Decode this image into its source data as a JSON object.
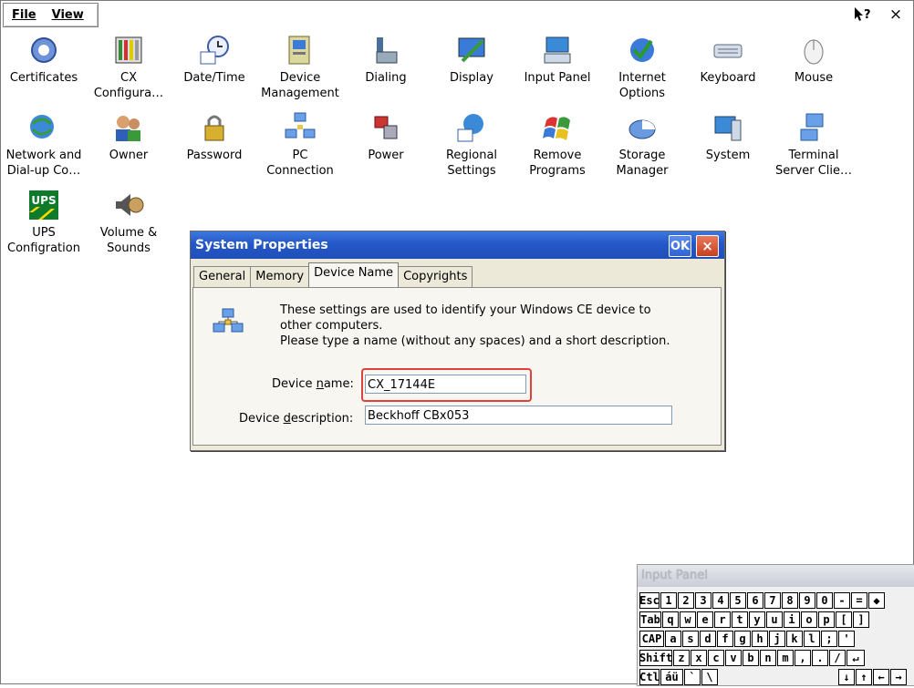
{
  "menu": {
    "file": "File",
    "view": "View"
  },
  "titlebar_controls": {
    "help": "?",
    "close": "×"
  },
  "icons": [
    {
      "label": "Certificates",
      "name": "certificates-icon"
    },
    {
      "label": "CX\nConfigura…",
      "name": "cx-configuration-icon"
    },
    {
      "label": "Date/Time",
      "name": "date-time-icon"
    },
    {
      "label": "Device\nManagement",
      "name": "device-management-icon"
    },
    {
      "label": "Dialing",
      "name": "dialing-icon"
    },
    {
      "label": "Display",
      "name": "display-icon"
    },
    {
      "label": "Input Panel",
      "name": "input-panel-icon"
    },
    {
      "label": "Internet\nOptions",
      "name": "internet-options-icon"
    },
    {
      "label": "Keyboard",
      "name": "keyboard-icon"
    },
    {
      "label": "Mouse",
      "name": "mouse-icon"
    },
    {
      "label": "Network and\nDial-up Co…",
      "name": "network-icon"
    },
    {
      "label": "Owner",
      "name": "owner-icon"
    },
    {
      "label": "Password",
      "name": "password-icon"
    },
    {
      "label": "PC\nConnection",
      "name": "pc-connection-icon"
    },
    {
      "label": "Power",
      "name": "power-icon"
    },
    {
      "label": "Regional\nSettings",
      "name": "regional-settings-icon"
    },
    {
      "label": "Remove\nPrograms",
      "name": "remove-programs-icon"
    },
    {
      "label": "Storage\nManager",
      "name": "storage-manager-icon"
    },
    {
      "label": "System",
      "name": "system-icon"
    },
    {
      "label": "Terminal\nServer Clie…",
      "name": "terminal-server-icon"
    },
    {
      "label": "UPS\nConfigration",
      "name": "ups-icon"
    },
    {
      "label": "Volume &\nSounds",
      "name": "volume-sounds-icon"
    }
  ],
  "dialog": {
    "title": "System Properties",
    "ok": "OK",
    "close": "×",
    "tabs": [
      "General",
      "Memory",
      "Device Name",
      "Copyrights"
    ],
    "active_tab": "Device Name",
    "intro": "These settings are used to identify your Windows CE device to\nother computers.\nPlease type a name (without any spaces) and a short description.",
    "device_name_label_pre": "Device ",
    "device_name_label_u": "n",
    "device_name_label_post": "ame:",
    "device_name": "CX_17144E",
    "device_desc_label_pre": "Device ",
    "device_desc_label_u": "d",
    "device_desc_label_post": "escription:",
    "device_description": "Beckhoff CBx053"
  },
  "input_panel": {
    "title": "Input Panel",
    "rows": [
      [
        "Esc",
        "1",
        "2",
        "3",
        "4",
        "5",
        "6",
        "7",
        "8",
        "9",
        "0",
        "-",
        "=",
        "◆"
      ],
      [
        "Tab",
        "q",
        "w",
        "e",
        "r",
        "t",
        "y",
        "u",
        "i",
        "o",
        "p",
        "[",
        "]"
      ],
      [
        "CAP",
        "a",
        "s",
        "d",
        "f",
        "g",
        "h",
        "j",
        "k",
        "l",
        ";",
        "'"
      ],
      [
        "Shift",
        "z",
        "x",
        "c",
        "v",
        "b",
        "n",
        "m",
        ",",
        ".",
        "/",
        "↵"
      ],
      [
        "Ctl",
        "áü",
        "`",
        "\\",
        "",
        "↓",
        "↑",
        "←",
        "→"
      ]
    ]
  },
  "colors": {
    "title_blue": "#2457c8",
    "highlight_red": "#e0413a",
    "dialog_bg": "#ece9d8"
  }
}
